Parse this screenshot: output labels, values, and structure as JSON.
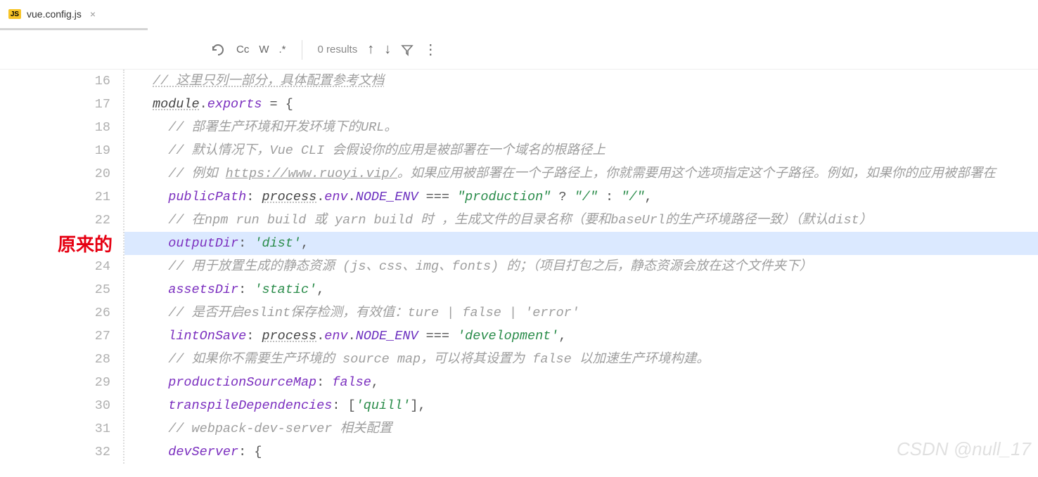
{
  "tab": {
    "icon_label": "JS",
    "filename": "vue.config.js"
  },
  "find": {
    "cc": "Cc",
    "w": "W",
    "regex": ".*",
    "results": "0 results"
  },
  "gutter": [
    "16",
    "17",
    "18",
    "19",
    "20",
    "21",
    "22",
    "",
    "24",
    "25",
    "26",
    "27",
    "28",
    "29",
    "30",
    "31",
    "32"
  ],
  "annotation": "原来的",
  "watermark": "CSDN @null_17",
  "code": {
    "l16": "// 这里只列一部分，具体配置参考文档",
    "l17_a": "module",
    "l17_b": ".",
    "l17_c": "exports",
    "l17_d": " = {",
    "l18": "// 部署生产环境和开发环境下的URL。",
    "l19": "// 默认情况下，Vue CLI 会假设你的应用是被部署在一个域名的根路径上",
    "l20_a": "// 例如 ",
    "l20_b": "https://www.ruoyi.vip/",
    "l20_c": "。如果应用被部署在一个子路径上，你就需要用这个选项指定这个子路径。例如，如果你的应用被部署在",
    "l21_a": "publicPath",
    "l21_b": ": ",
    "l21_c": "process",
    "l21_d": ".",
    "l21_e": "env",
    "l21_f": ".",
    "l21_g": "NODE_ENV",
    "l21_h": " === ",
    "l21_i": "\"production\"",
    "l21_j": " ? ",
    "l21_k": "\"/\"",
    "l21_l": " : ",
    "l21_m": "\"/\"",
    "l21_n": ",",
    "l22": "// 在npm run build 或 yarn build 时 ，生成文件的目录名称（要和baseUrl的生产环境路径一致）（默认dist）",
    "l23_a": "outputDir",
    "l23_b": ": ",
    "l23_c": "'dist'",
    "l23_d": ",",
    "l24": "// 用于放置生成的静态资源 (js、css、img、fonts) 的；（项目打包之后，静态资源会放在这个文件夹下）",
    "l25_a": "assetsDir",
    "l25_b": ": ",
    "l25_c": "'static'",
    "l25_d": ",",
    "l26": "// 是否开启eslint保存检测，有效值：ture | false | 'error'",
    "l27_a": "lintOnSave",
    "l27_b": ": ",
    "l27_c": "process",
    "l27_d": ".",
    "l27_e": "env",
    "l27_f": ".",
    "l27_g": "NODE_ENV",
    "l27_h": " === ",
    "l27_i": "'development'",
    "l27_j": ",",
    "l28": "// 如果你不需要生产环境的 source map，可以将其设置为 false 以加速生产环境构建。",
    "l29_a": "productionSourceMap",
    "l29_b": ": ",
    "l29_c": "false",
    "l29_d": ",",
    "l30_a": "transpileDependencies",
    "l30_b": ": [",
    "l30_c": "'quill'",
    "l30_d": "],",
    "l31": "// webpack-dev-server 相关配置",
    "l32_a": "devServer",
    "l32_b": ": {"
  }
}
